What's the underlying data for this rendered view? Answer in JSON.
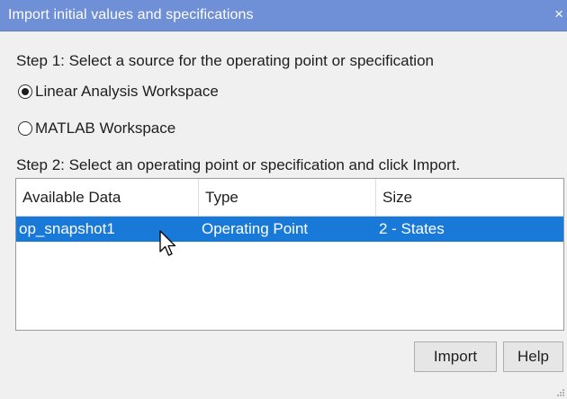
{
  "window": {
    "title": "Import initial values and specifications",
    "close_glyph": "×"
  },
  "step1": {
    "label": "Step 1: Select a source for the operating point or specification",
    "options": [
      {
        "label": "Linear Analysis Workspace",
        "selected": true
      },
      {
        "label": "MATLAB Workspace",
        "selected": false
      }
    ]
  },
  "step2": {
    "label": "Step 2: Select an operating point or specification and click Import."
  },
  "table": {
    "columns": [
      "Available Data",
      "Type",
      "Size"
    ],
    "rows": [
      {
        "name": "op_snapshot1",
        "type": "Operating Point",
        "size": "2 - States",
        "selected": true
      }
    ]
  },
  "buttons": {
    "import_label": "Import",
    "help_label": "Help"
  },
  "icons": {
    "radio": "radio-button-icon",
    "cursor": "mouse-pointer-icon",
    "grip": "resize-grip-icon",
    "close": "close-icon"
  },
  "colors": {
    "titlebar": "#6f8fd6",
    "selection": "#1879d8",
    "background": "#f0f0f0"
  }
}
